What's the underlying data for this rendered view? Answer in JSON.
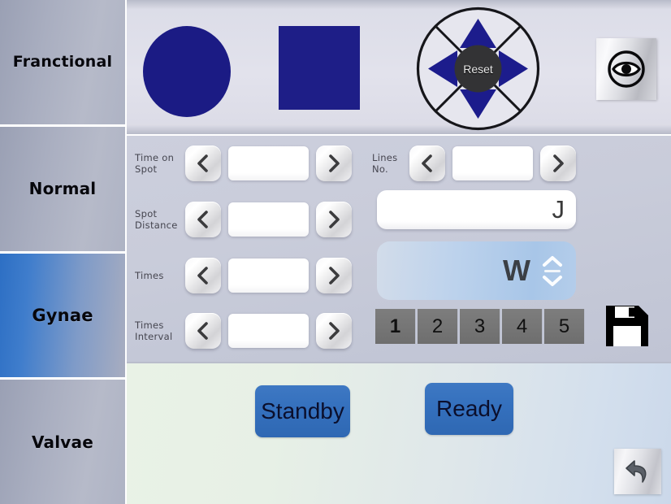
{
  "sidebar": {
    "items": [
      {
        "label": "Franctional",
        "active": false
      },
      {
        "label": "Normal",
        "active": false
      },
      {
        "label": "Gynae",
        "active": true
      },
      {
        "label": "Valvae",
        "active": false
      }
    ]
  },
  "toolbar": {
    "shape_circle": "circle-shape",
    "shape_square": "square-shape",
    "dpad": {
      "reset_label": "Reset",
      "up": "up-arrow",
      "down": "down-arrow",
      "left": "left-arrow",
      "right": "right-arrow"
    },
    "eye_button": "eye-icon"
  },
  "form": {
    "left_rows": [
      {
        "label_line1": "Time on",
        "label_line2": "Spot",
        "value": "",
        "dec": "‹",
        "inc": "›"
      },
      {
        "label_line1": "Spot",
        "label_line2": "Distance",
        "value": "",
        "dec": "‹",
        "inc": "›"
      },
      {
        "label_line1": "Times",
        "label_line2": "",
        "value": "",
        "dec": "‹",
        "inc": "›"
      },
      {
        "label_line1": "Times",
        "label_line2": "Interval",
        "value": "",
        "dec": "‹",
        "inc": "›"
      }
    ],
    "lines_no": {
      "label_line1": "Lines",
      "label_line2": "No.",
      "value": ""
    },
    "energy_field": {
      "value": "",
      "unit": "J"
    },
    "power_field": {
      "value": "",
      "unit": "W"
    },
    "presets": [
      {
        "label": "1",
        "active": true
      },
      {
        "label": "2",
        "active": false
      },
      {
        "label": "3",
        "active": false
      },
      {
        "label": "4",
        "active": false
      },
      {
        "label": "5",
        "active": false
      }
    ],
    "save_button": "save-floppy-icon"
  },
  "bottom": {
    "standby_label": "Standby",
    "ready_label": "Ready",
    "back_button": "undo-arrow-icon"
  },
  "colors": {
    "shape_navy": "#1b1b84",
    "accent_blue": "#3470bd",
    "sidebar_active": "#2d6fc4",
    "preset_gray": "#767676"
  }
}
